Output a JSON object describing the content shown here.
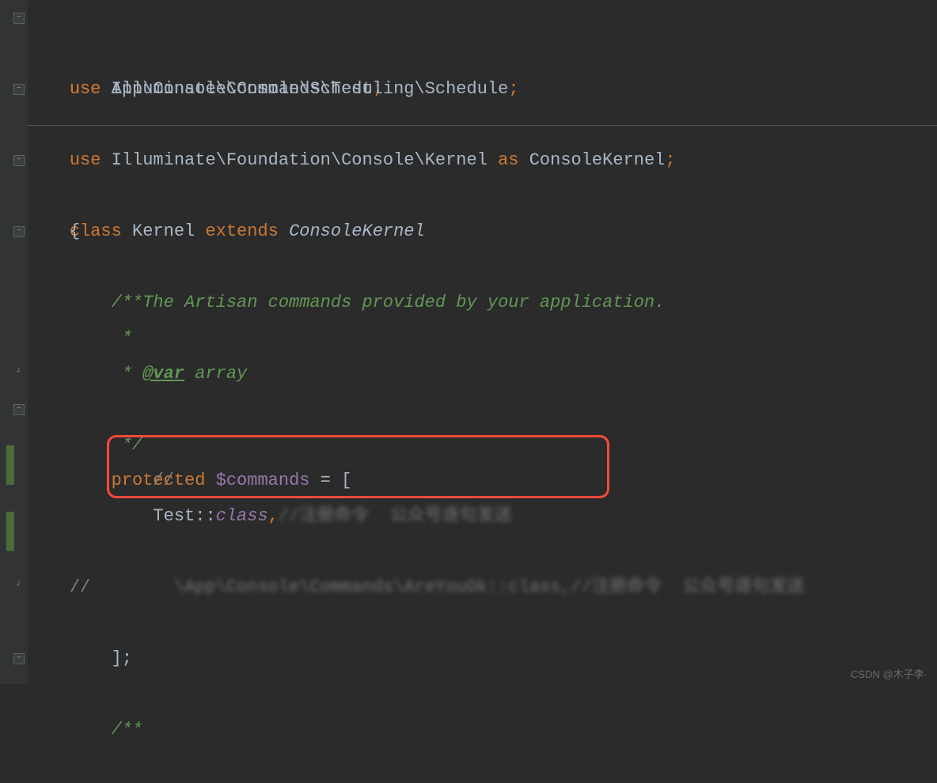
{
  "lines": {
    "l1_kw": "use",
    "l1_ns": " App\\Console\\Commands\\Test",
    "l1_semi": ";",
    "l2_kw": "use",
    "l2_ns": " Illuminate\\Console\\Scheduling\\Schedule",
    "l2_semi": ";",
    "l3_kw": "use",
    "l3_ns": " Illuminate\\Foundation\\Console\\Kernel ",
    "l3_as": "as",
    "l3_alias": " ConsoleKernel",
    "l3_semi": ";",
    "l5_class": "class",
    "l5_name": " Kernel ",
    "l5_extends": "extends",
    "l5_parent": " ConsoleKernel",
    "l6_brace": "{",
    "doc_open": "    /**",
    "doc_line1": "     * The Artisan commands provided by your application.",
    "doc_star": "     *",
    "doc_var_pre": "     * ",
    "doc_var_tag": "@var",
    "doc_var_post": " array",
    "doc_close": "     */",
    "prot_kw": "    protected",
    "prot_var": " $commands",
    "prot_eq": " = [",
    "slash": "        //",
    "test_pre": "        Test",
    "test_colon": "::",
    "test_class": "class",
    "test_comma": ",",
    "test_comment": "//注册命令  公众号逐句发送",
    "comm_slash": "//",
    "comm_blur": "        \\App\\Console\\Commands\\AreYouOk::class,//注册命令  公众号逐句发送",
    "close_arr": "    ];",
    "doc2_open": "    /**"
  },
  "watermark": "CSDN @木子李·"
}
